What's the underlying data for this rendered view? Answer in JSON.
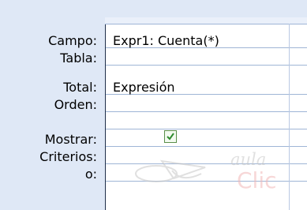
{
  "row_labels": {
    "campo": "Campo:",
    "tabla": "Tabla:",
    "total": "Total:",
    "orden": "Orden:",
    "mostrar": "Mostrar:",
    "criterios": "Criterios:",
    "o": "o:"
  },
  "column": {
    "campo": "Expr1: Cuenta(*)",
    "tabla": "",
    "total": "Expresión",
    "orden": "",
    "mostrar_checked": true,
    "criterios": "",
    "o": ""
  },
  "watermark": {
    "top": "aula",
    "bottom": "Clic"
  },
  "colors": {
    "grid_line": "#9fb5d6",
    "frame_bg": "#dfe8f6",
    "check_green": "#2e8b2e"
  }
}
